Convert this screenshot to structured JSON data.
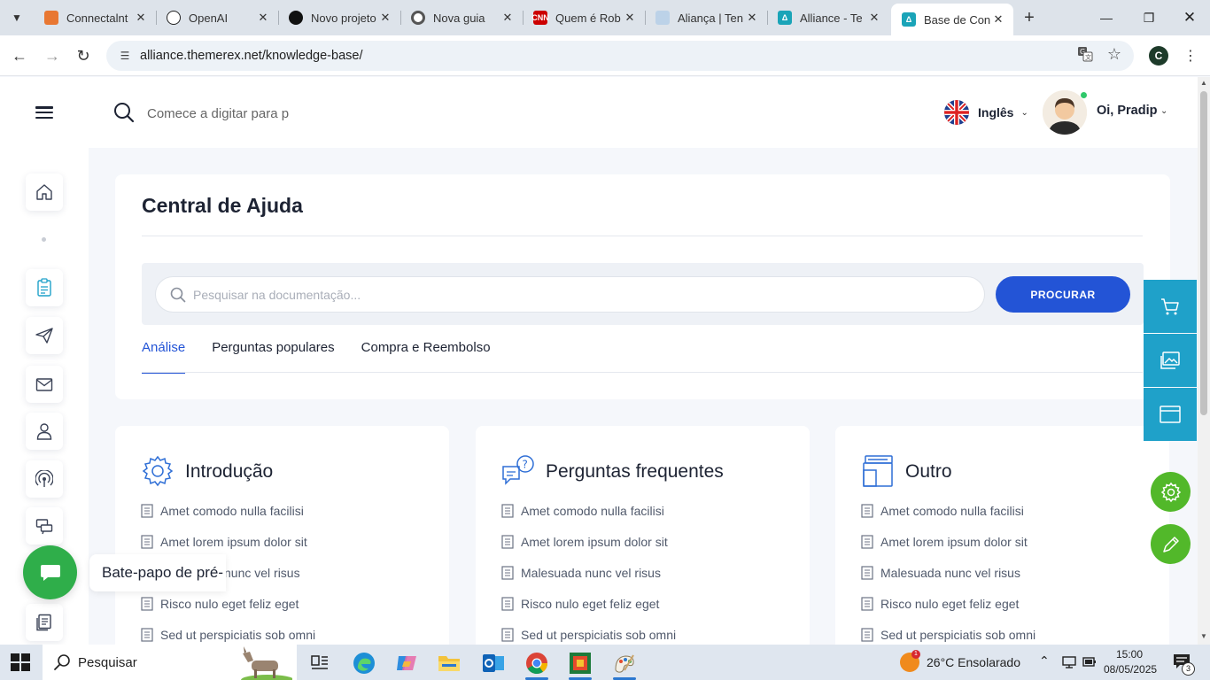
{
  "browser": {
    "tabs": [
      {
        "label": "Connectalnt",
        "favicon": "#e87732"
      },
      {
        "label": "OpenAI",
        "favicon": "#222222"
      },
      {
        "label": "Novo projeto",
        "favicon": "#111111"
      },
      {
        "label": "Nova guia",
        "favicon": "#555555"
      },
      {
        "label": "Quem é Rob",
        "favicon": "#cc0000"
      },
      {
        "label": "Aliança | Ten",
        "favicon": "#bcd2e8"
      },
      {
        "label": "Alliance - Te",
        "favicon": "#1aa4b8"
      },
      {
        "label": "Base de Con",
        "favicon": "#1aa4b8",
        "active": true
      }
    ],
    "url": "alliance.themerex.net/knowledge-base/",
    "profile_initial": "C"
  },
  "header": {
    "search_placeholder": "Comece a digitar para p",
    "language": "Inglês",
    "greeting": "Oi,  Pradip"
  },
  "main": {
    "title": "Central de Ajuda",
    "doc_search_placeholder": "Pesquisar na documentação...",
    "search_button": "PROCURAR",
    "tabs": [
      "Análise",
      "Perguntas populares",
      "Compra e Reembolso"
    ],
    "active_tab": "Análise"
  },
  "categories": [
    {
      "title": "Introdução",
      "icon": "gear-icon",
      "items": [
        "Amet comodo nulla facilisi",
        "Amet lorem ipsum dolor sit",
        "nunc vel risus",
        "Risco nulo eget feliz eget",
        "Sed ut perspiciatis sob omni"
      ]
    },
    {
      "title": "Perguntas frequentes",
      "icon": "question-chat-icon",
      "items": [
        "Amet comodo nulla facilisi",
        "Amet lorem ipsum dolor sit",
        "Malesuada nunc vel risus",
        "Risco nulo eget feliz eget",
        "Sed ut perspiciatis sob omni"
      ]
    },
    {
      "title": "Outro",
      "icon": "stack-icon",
      "items": [
        "Amet comodo nulla facilisi",
        "Amet lorem ipsum dolor sit",
        "Malesuada nunc vel risus",
        "Risco nulo eget feliz eget",
        "Sed ut perspiciatis sob omni"
      ]
    }
  ],
  "chat": {
    "label": "Bate-papo de pré-"
  },
  "taskbar": {
    "search_label": "Pesquisar",
    "weather": "26°C  Ensolarado",
    "time": "15:00",
    "date": "08/05/2025",
    "notification_count": "3"
  },
  "colors": {
    "accent": "#2354d6",
    "teal": "#1fa1c9",
    "green": "#52b82a"
  }
}
